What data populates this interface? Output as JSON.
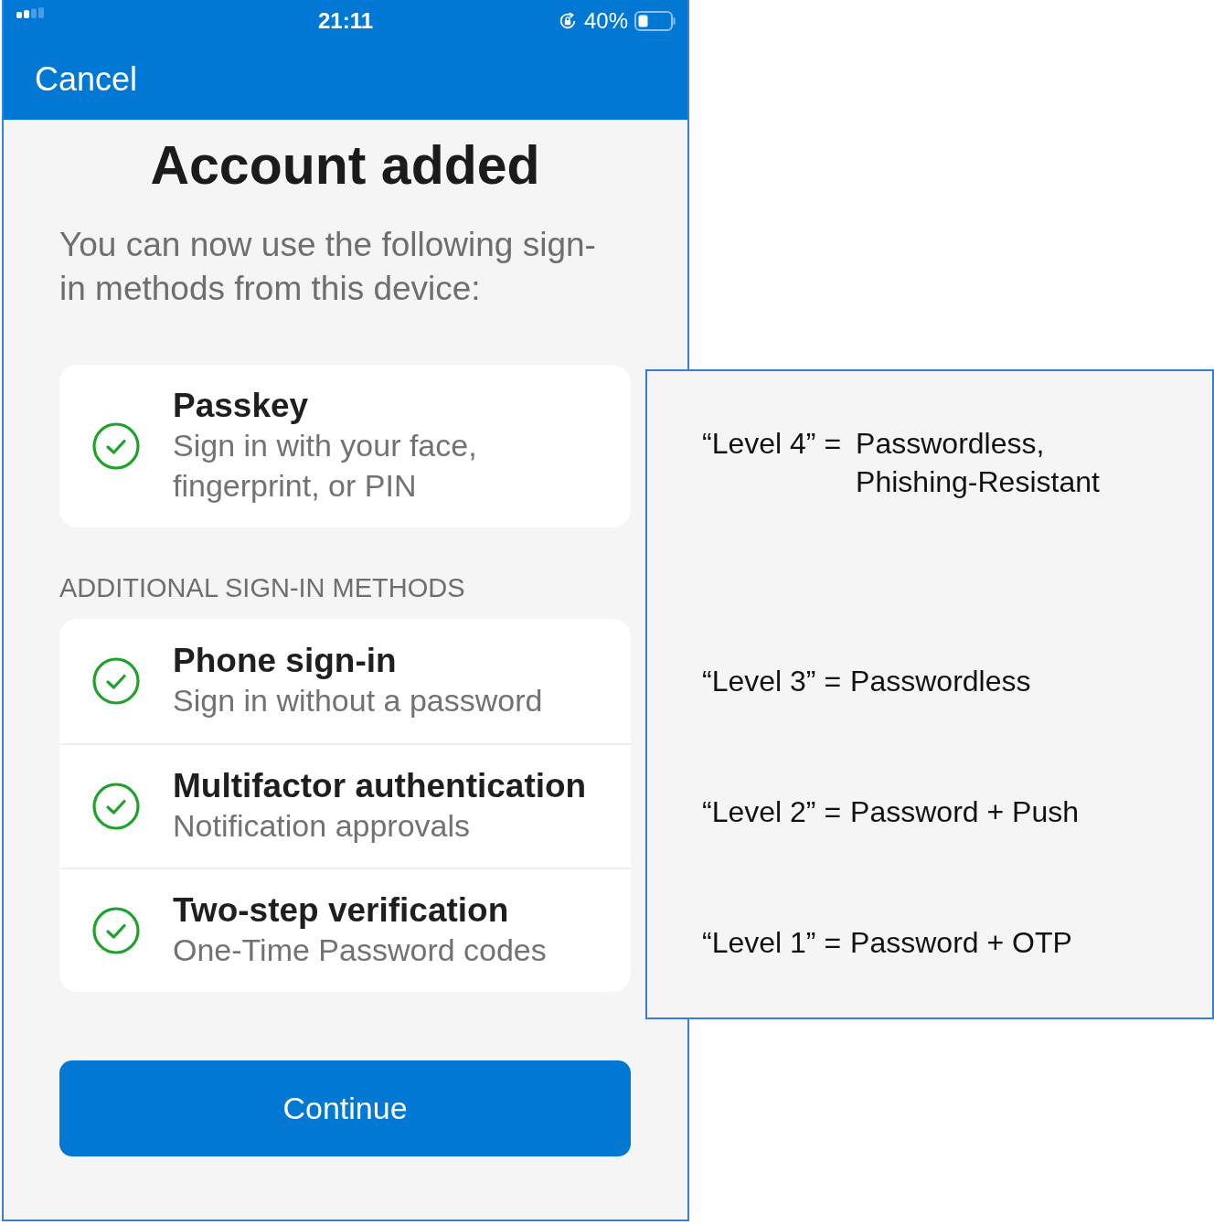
{
  "status_bar": {
    "time": "21:11",
    "battery": "40%"
  },
  "nav": {
    "cancel": "Cancel"
  },
  "title": "Account added",
  "intro": "You can now use the following sign-in methods from this device:",
  "primary_method": {
    "title": "Passkey",
    "description": "Sign in with your face, fingerprint, or PIN",
    "checked": true
  },
  "section_header": "ADDITIONAL SIGN-IN METHODS",
  "additional_methods": [
    {
      "title": "Phone sign-in",
      "description": "Sign in without a password",
      "checked": true
    },
    {
      "title": "Multifactor authentication",
      "description": "Notification approvals",
      "checked": true
    },
    {
      "title": "Two-step verification",
      "description": "One-Time Password codes",
      "checked": true
    }
  ],
  "continue_button": "Continue",
  "annotation": {
    "levels": [
      {
        "label": "“Level 4” =",
        "description": "Passwordless, Phishing-Resistant"
      },
      {
        "label": "“Level 3” =",
        "description": "Passwordless"
      },
      {
        "label": "“Level 2” =",
        "description": "Password + Push"
      },
      {
        "label": "“Level 1” =",
        "description": "Password + OTP"
      }
    ]
  }
}
